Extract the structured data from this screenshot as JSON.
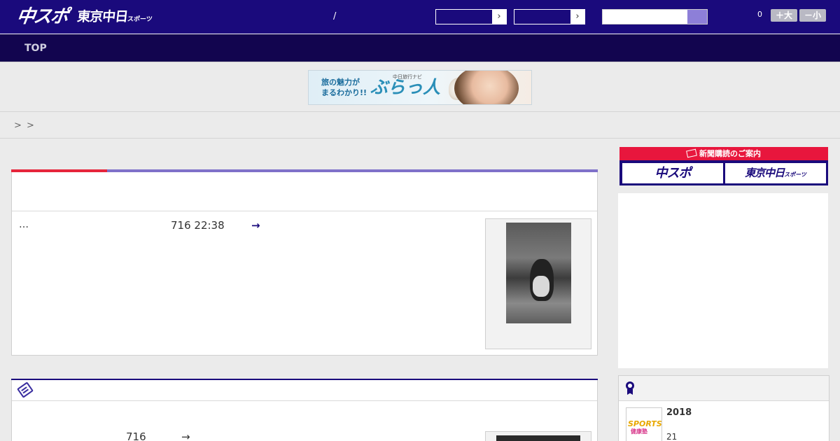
{
  "header": {
    "logo_chuspo": "中スポ",
    "logo_tokyo": "東京中日",
    "logo_tokyo_small": "スポーツ",
    "slash": "/",
    "select_arrow": "›",
    "search_placeholder": "",
    "font_count": "0",
    "font_large_label": "＋大",
    "font_small_label": "－小"
  },
  "nav": {
    "top_label": "TOP"
  },
  "banner": {
    "left_text_line1": "旅の魅力が",
    "left_text_line2": "まるわかり!!",
    "brand_sub": "中日旅行ナビ",
    "brand_main": "ぶらっ人"
  },
  "breadcrumb": {
    "sep1": ">",
    "sep2": ">"
  },
  "article": {
    "ellipsis": "…",
    "date": "716 22:38",
    "arrow": "→"
  },
  "section2": {
    "count": "716",
    "arrow": "→"
  },
  "sidebar": {
    "subscribe_title": "新聞購読のご案内",
    "subscribe_btn1": "中スポ",
    "subscribe_btn2": "東京中日",
    "subscribe_btn2_small": "スポーツ",
    "ranking_year": "2018",
    "ranking_number": "21",
    "thumb_text1": "SPORTS!!",
    "thumb_text2": "健康塾"
  }
}
